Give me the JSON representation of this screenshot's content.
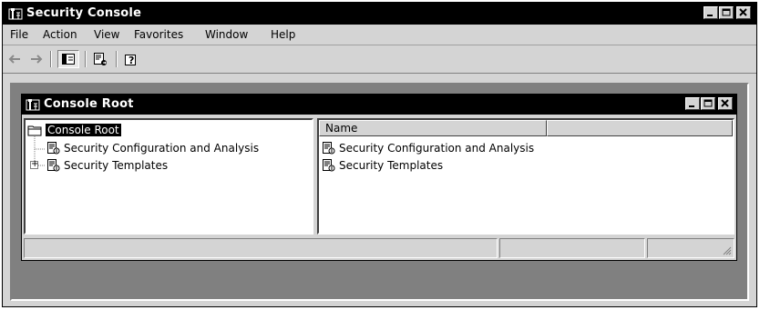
{
  "app": {
    "title": "Security Console",
    "menu": [
      "File",
      "Action",
      "View",
      "Favorites",
      "Window",
      "Help"
    ]
  },
  "child_window": {
    "title": "Console Root",
    "tree": [
      {
        "label": "Console Root",
        "selected": true,
        "icon": "folder-icon"
      },
      {
        "label": "Security Configuration and Analysis",
        "icon": "snapin-icon"
      },
      {
        "label": "Security Templates",
        "icon": "snapin-icon",
        "expandable": true,
        "expander": "+"
      }
    ],
    "list_header": [
      "Name",
      ""
    ],
    "list_items": [
      {
        "label": "Security Configuration and Analysis",
        "icon": "snapin-icon"
      },
      {
        "label": "Security Templates",
        "icon": "snapin-icon"
      }
    ]
  },
  "colors": {
    "titlebar": "#000000",
    "face": "#d4d4d4",
    "workspace": "#808080"
  }
}
